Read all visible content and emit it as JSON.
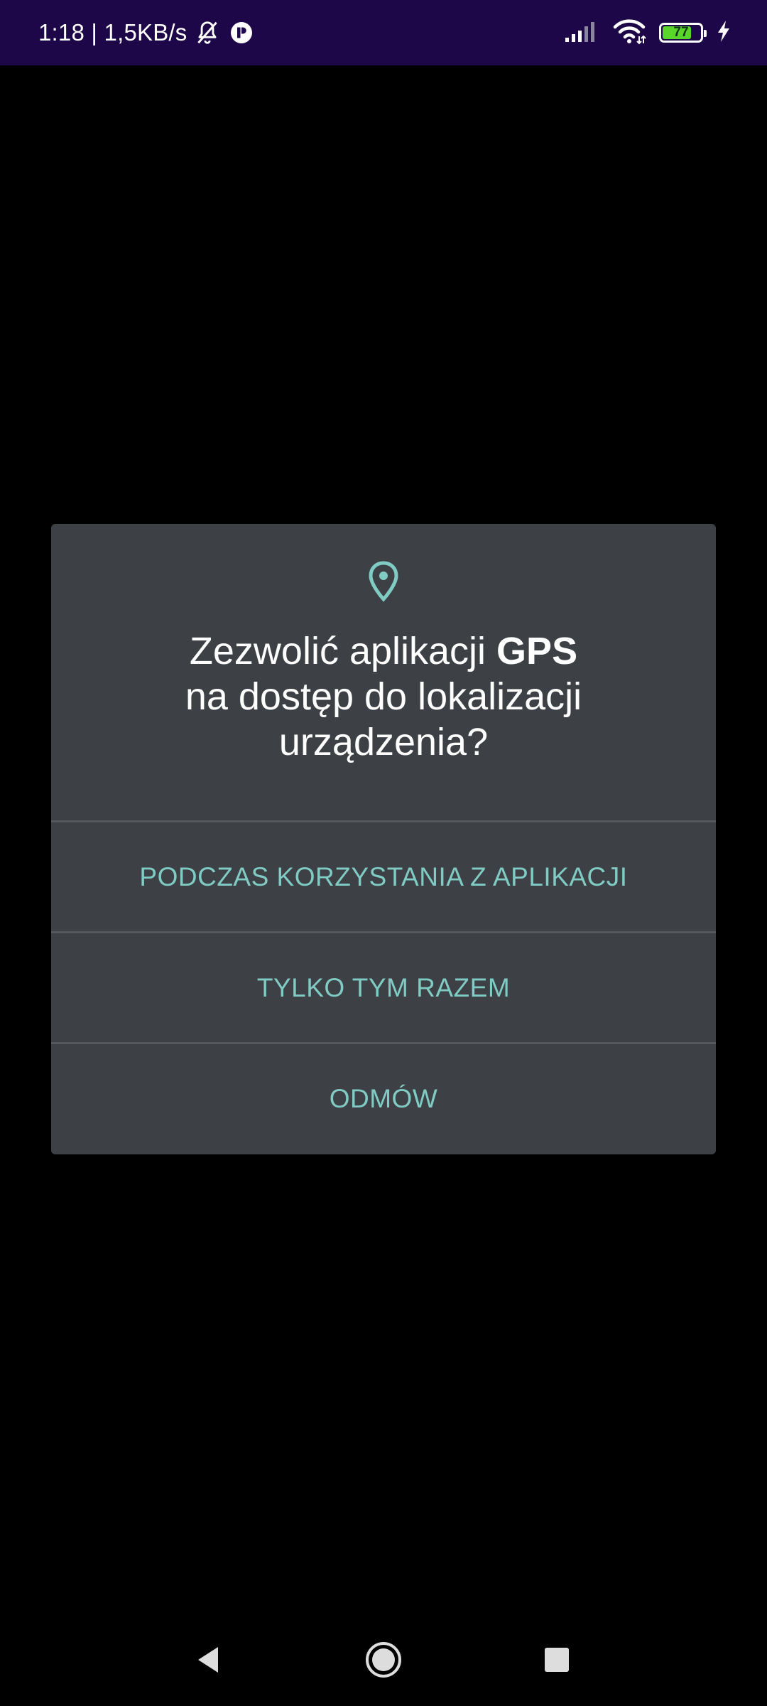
{
  "status_bar": {
    "time_speed": "1:18 | 1,5KB/s",
    "icons": [
      "notifications-off-icon",
      "app-notification-icon",
      "signal-icon",
      "wifi-icon",
      "battery-icon",
      "charging-icon"
    ],
    "battery_level": "77",
    "battery_fraction": 0.77,
    "background_color": "#1d0748"
  },
  "dialog": {
    "icon": "location-pin-icon",
    "title_prefix": "Zezwolić aplikacji ",
    "app_name": "GPS",
    "title_line2": "na dostęp do lokalizacji",
    "title_line3": "urządzenia?",
    "options": [
      {
        "label": "PODCZAS KORZYSTANIA Z APLIKACJI"
      },
      {
        "label": "TYLKO TYM RAZEM"
      },
      {
        "label": "ODMÓW"
      }
    ],
    "accent_color": "#80cbc4",
    "background_color": "#3d4145"
  },
  "nav_bar": {
    "buttons": [
      "back-icon",
      "home-icon",
      "recents-icon"
    ]
  }
}
